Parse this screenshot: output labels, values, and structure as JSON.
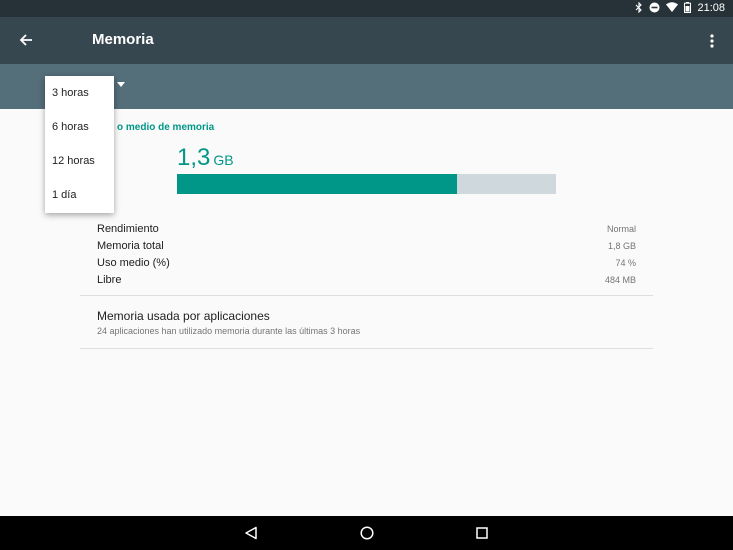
{
  "status_bar": {
    "time": "21:08"
  },
  "app_bar": {
    "title": "Memoria"
  },
  "dropdown": {
    "options": [
      "3 horas",
      "6 horas",
      "12 horas",
      "1 día"
    ]
  },
  "memory": {
    "section_label": "o medio de memoria",
    "value": "1,3",
    "unit": "GB",
    "usage_fraction": 0.74
  },
  "stats": [
    {
      "label": "Rendimiento",
      "value": "Normal"
    },
    {
      "label": "Memoria total",
      "value": "1,8 GB"
    },
    {
      "label": "Uso medio (%)",
      "value": "74 %"
    },
    {
      "label": "Libre",
      "value": "484 MB"
    }
  ],
  "apps_entry": {
    "title": "Memoria usada por aplicaciones",
    "subtitle": "24 aplicaciones han utilizado memoria durante las últimas 3 horas"
  },
  "colors": {
    "accent": "#009688",
    "app_bar": "#37474f",
    "sub_bar": "#546e7a",
    "status_bar": "#263238"
  },
  "icons": [
    "bluetooth-icon",
    "do-not-disturb-icon",
    "wifi-icon",
    "battery-icon",
    "back-arrow-icon",
    "overflow-menu-icon",
    "spinner-arrow-icon",
    "nav-back-icon",
    "nav-home-icon",
    "nav-recents-icon"
  ]
}
